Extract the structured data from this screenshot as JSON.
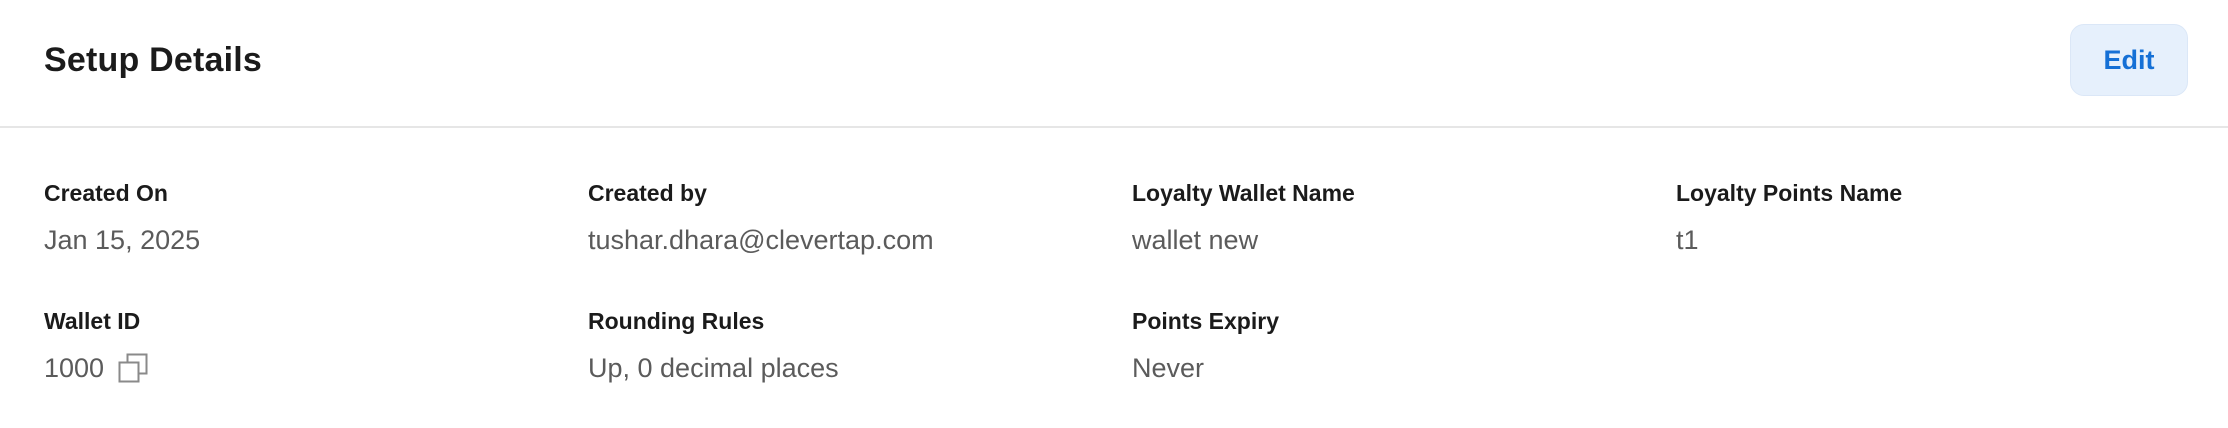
{
  "header": {
    "title": "Setup Details",
    "edit_label": "Edit"
  },
  "fields": {
    "created_on": {
      "label": "Created On",
      "value": "Jan 15, 2025"
    },
    "created_by": {
      "label": "Created by",
      "value": "tushar.dhara@clevertap.com"
    },
    "loyalty_wallet_name": {
      "label": "Loyalty Wallet Name",
      "value": "wallet new"
    },
    "loyalty_points_name": {
      "label": "Loyalty Points Name",
      "value": "t1"
    },
    "wallet_id": {
      "label": "Wallet ID",
      "value": "1000",
      "icon": "copy-icon"
    },
    "rounding_rules": {
      "label": "Rounding Rules",
      "value": "Up, 0 decimal places"
    },
    "points_expiry": {
      "label": "Points Expiry",
      "value": "Never"
    }
  },
  "colors": {
    "accent": "#1570d6",
    "accent_bg": "#e6f0fc",
    "label": "#1b1b1b",
    "value": "#5b5b5b",
    "divider": "#e6e6e6"
  }
}
